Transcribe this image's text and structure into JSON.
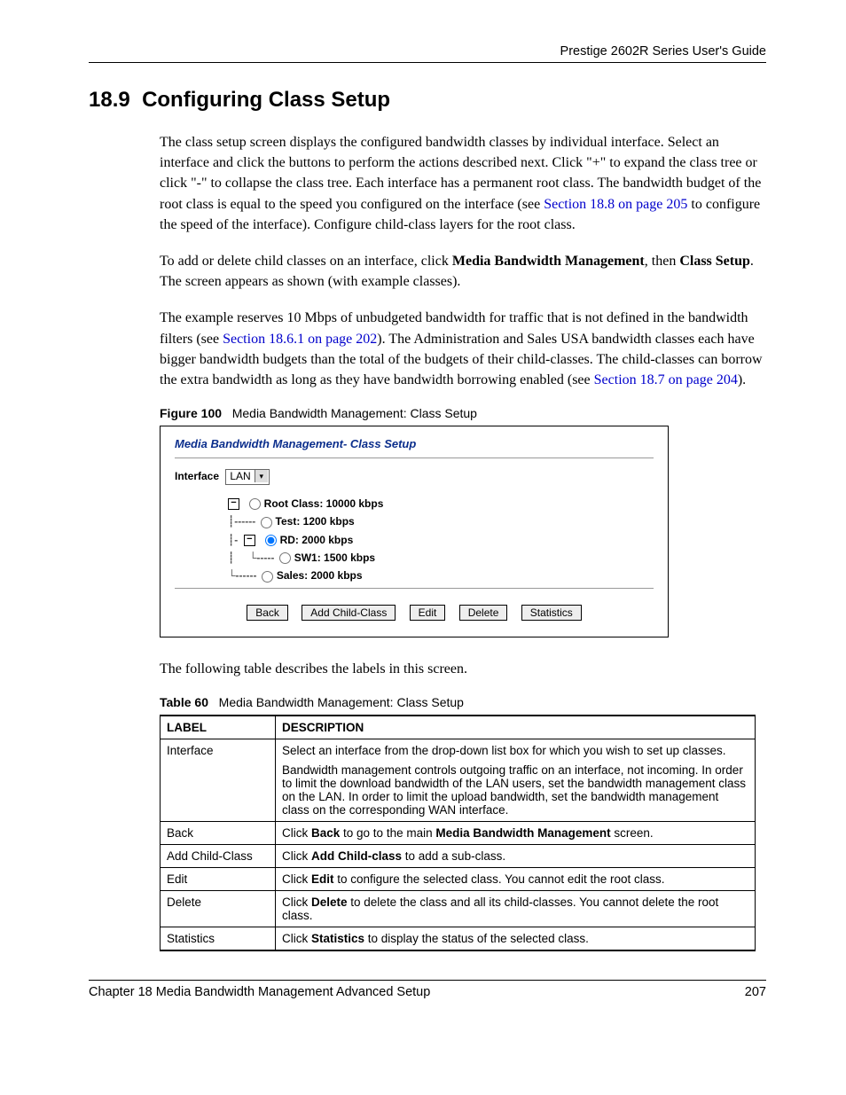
{
  "header": {
    "guide": "Prestige 2602R Series User's Guide"
  },
  "section": {
    "number": "18.9",
    "title": "Configuring Class Setup"
  },
  "paras": {
    "p1a": "The class setup screen displays the configured bandwidth classes by individual interface. Select an interface and click the buttons to perform the actions described next. Click \"+\" to expand the class tree or click \"-\" to collapse the class tree. Each interface has a permanent root class. The bandwidth budget of the root class is equal to the speed you configured on the interface (see ",
    "p1_link": "Section 18.8 on page 205",
    "p1b": " to configure the speed of the interface). Configure child-class layers for the root class.",
    "p2a": "To add or delete child classes on an interface, click ",
    "p2_b1": "Media Bandwidth Management",
    "p2b": ", then ",
    "p2_b2": "Class Setup",
    "p2c": ". The screen appears as shown (with example classes).",
    "p3a": "The example reserves 10 Mbps of unbudgeted bandwidth for traffic that is not defined in the bandwidth filters (see ",
    "p3_link1": "Section 18.6.1 on page 202",
    "p3b": "). The Administration and Sales USA bandwidth classes each have bigger bandwidth budgets than the total of the budgets of their child-classes. The child-classes can borrow the extra bandwidth as long as they have bandwidth borrowing enabled (see ",
    "p3_link2": "Section 18.7 on page 204",
    "p3c": ").",
    "after_fig": "The following table describes the labels in this screen."
  },
  "figure": {
    "label": "Figure 100",
    "caption": "Media Bandwidth Management: Class Setup",
    "shot_title": "Media Bandwidth Management- Class Setup",
    "iface_label": "Interface",
    "iface_value": "LAN",
    "tree": {
      "root": "Root Class: 10000 kbps",
      "test": "Test: 1200 kbps",
      "rd": "RD: 2000 kbps",
      "sw1": "SW1: 1500 kbps",
      "sales": "Sales: 2000 kbps"
    },
    "buttons": {
      "back": "Back",
      "add": "Add Child-Class",
      "edit": "Edit",
      "delete": "Delete",
      "stats": "Statistics"
    }
  },
  "table": {
    "label": "Table 60",
    "caption": "Media Bandwidth Management: Class Setup",
    "head_label": "LABEL",
    "head_desc": "DESCRIPTION",
    "rows": {
      "interface_label": "Interface",
      "interface_p1": "Select an interface from the drop-down list box for which you wish to set up classes.",
      "interface_p2": "Bandwidth management controls outgoing traffic on an interface, not incoming. In order to limit the download bandwidth of the LAN users, set the bandwidth management class on the LAN. In order to limit the upload bandwidth, set the bandwidth management class on the corresponding WAN interface.",
      "back_label": "Back",
      "back_a": "Click ",
      "back_b1": "Back",
      "back_b": " to go to the main ",
      "back_b2": "Media Bandwidth Management",
      "back_c": " screen.",
      "add_label": "Add Child-Class",
      "add_a": "Click ",
      "add_b1": "Add Child-class",
      "add_b": " to add a sub-class.",
      "edit_label": "Edit",
      "edit_a": "Click ",
      "edit_b1": "Edit",
      "edit_b": " to configure the selected class. You cannot edit the root class.",
      "delete_label": "Delete",
      "delete_a": "Click ",
      "delete_b1": "Delete",
      "delete_b": " to delete the class and all its child-classes. You cannot delete the root class.",
      "stats_label": "Statistics",
      "stats_a": "Click ",
      "stats_b1": "Statistics",
      "stats_b": " to display the status of the selected class."
    }
  },
  "footer": {
    "chapter": "Chapter 18 Media Bandwidth Management Advanced Setup",
    "page": "207"
  }
}
